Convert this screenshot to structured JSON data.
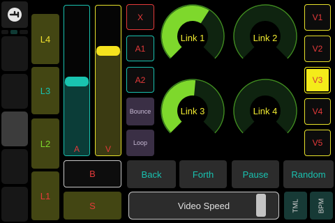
{
  "left_column": {
    "logo_icon": "connection-plug-icon",
    "pads": [
      "",
      "",
      "",
      "",
      ""
    ]
  },
  "l_buttons": [
    {
      "label": "L4",
      "color": "#f2e12f"
    },
    {
      "label": "L3",
      "color": "#19c2b0"
    },
    {
      "label": "L2",
      "color": "#7ed82c"
    },
    {
      "label": "L1",
      "color": "#e53a3a"
    }
  ],
  "faders": {
    "a": {
      "label": "A",
      "value": 0.45,
      "label_color": "#e53a3a"
    },
    "v": {
      "label": "V",
      "value": 0.7,
      "label_color": "#e53a3a"
    }
  },
  "square_buttons": {
    "x": "X",
    "a1": "A1",
    "a2": "A2",
    "bounce": "Bounce",
    "loop": "Loop"
  },
  "knobs": [
    {
      "label": "Link 1",
      "value": 0.62
    },
    {
      "label": "Link 2",
      "value": 0.0
    },
    {
      "label": "Link 3",
      "value": 0.52
    },
    {
      "label": "Link 4",
      "value": 0.0
    }
  ],
  "v_buttons": [
    {
      "label": "V1",
      "selected": false
    },
    {
      "label": "V2",
      "selected": false
    },
    {
      "label": "V3",
      "selected": true
    },
    {
      "label": "V4",
      "selected": false
    },
    {
      "label": "V5",
      "selected": false
    }
  ],
  "bottom": {
    "b_label": "B",
    "s_label": "S",
    "transport": [
      "Back",
      "Forth",
      "Pause",
      "Random"
    ],
    "speed_label": "Video Speed",
    "speed_value": 0.93,
    "tml_label": "TML",
    "bpm_label": "BPM"
  },
  "colors": {
    "teal": "#19c2b0",
    "yellow": "#f2e12f",
    "green": "#7ed82c",
    "red": "#e53a3a"
  }
}
